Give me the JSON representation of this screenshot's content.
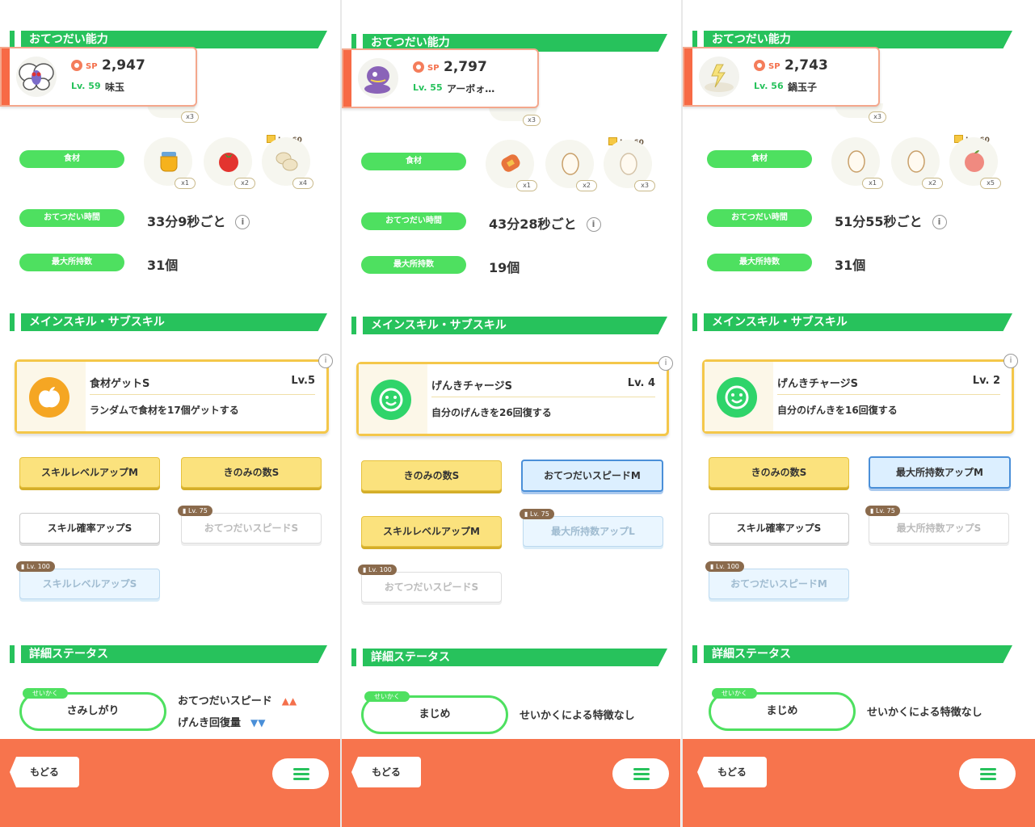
{
  "colors": {
    "green": "#27c25c",
    "orange": "#f7744d",
    "gold": "#fbe27d",
    "blue": "#4a8fd8"
  },
  "labels": {
    "help_section": "おてつだい能力",
    "skill_section": "メインスキル・サブスキル",
    "detail_section": "詳細ステータス",
    "ingredient": "食材",
    "help_time": "おてつだい時間",
    "max_carry": "最大所持数",
    "nature_tag": "せいかく",
    "back": "もどる",
    "sp": "SP",
    "info": "i",
    "locked_icon": "lock-icon",
    "menu_icon": "hamburger-menu-icon"
  },
  "panels": [
    {
      "pokemon": {
        "sp_value": "2,947",
        "level": "Lv. 59",
        "name": "味玉",
        "avatar": "butterfree-icon"
      },
      "top_count": "x3",
      "ingredients": [
        {
          "icon": "honey-icon",
          "count": "x1",
          "lock": ""
        },
        {
          "icon": "tomato-icon",
          "count": "x2",
          "lock": ""
        },
        {
          "icon": "potato-icon",
          "count": "x4",
          "lock": "Lv. 60"
        }
      ],
      "help_time": "33分9秒ごと",
      "max_carry": "31個",
      "main_skill": {
        "name": "食材ゲットS",
        "level": "Lv.5",
        "desc": "ランダムで食材を17個ゲットする",
        "icon": "apple-icon"
      },
      "sub_skills": [
        {
          "label": "スキルレベルアップM",
          "style": "gold",
          "lock": ""
        },
        {
          "label": "きのみの数S",
          "style": "gold",
          "lock": ""
        },
        {
          "label": "スキル確率アップS",
          "style": "white",
          "lock": ""
        },
        {
          "label": "おてつだいスピードS",
          "style": "lwhite",
          "lock": "Lv. 75"
        },
        {
          "label": "スキルレベルアップS",
          "style": "lblue",
          "lock": "Lv. 100"
        }
      ],
      "nature": {
        "name": "さみしがり",
        "up": "おてつだいスピード",
        "up_mark": "▲▲",
        "down": "げんき回復量",
        "down_mark": "▼▼",
        "none": ""
      }
    },
    {
      "pokemon": {
        "sp_value": "2,797",
        "level": "Lv. 55",
        "name": "アーボォ…",
        "avatar": "ekans-icon"
      },
      "top_count": "x3",
      "ingredients": [
        {
          "icon": "sausage-icon",
          "count": "x1",
          "lock": ""
        },
        {
          "icon": "egg-icon",
          "count": "x2",
          "lock": ""
        },
        {
          "icon": "egg-icon",
          "count": "x3",
          "lock": "Lv. 60"
        }
      ],
      "help_time": "43分28秒ごと",
      "max_carry": "19個",
      "main_skill": {
        "name": "げんきチャージS",
        "level": "Lv. 4",
        "desc": "自分のげんきを26回復する",
        "icon": "smile-icon"
      },
      "sub_skills": [
        {
          "label": "きのみの数S",
          "style": "gold",
          "lock": ""
        },
        {
          "label": "おてつだいスピードM",
          "style": "blue",
          "lock": ""
        },
        {
          "label": "スキルレベルアップM",
          "style": "gold",
          "lock": ""
        },
        {
          "label": "最大所持数アップL",
          "style": "lblue",
          "lock": "Lv. 75"
        },
        {
          "label": "おてつだいスピードS",
          "style": "lwhite",
          "lock": "Lv. 100"
        }
      ],
      "nature": {
        "name": "まじめ",
        "up": "",
        "up_mark": "",
        "down": "",
        "down_mark": "",
        "none": "せいかくによる特徴なし"
      }
    },
    {
      "pokemon": {
        "sp_value": "2,743",
        "level": "Lv. 56",
        "name": "鍋玉子",
        "avatar": "pichu-icon"
      },
      "top_count": "x3",
      "ingredients": [
        {
          "icon": "egg-icon",
          "count": "x1",
          "lock": ""
        },
        {
          "icon": "egg-icon",
          "count": "x2",
          "lock": ""
        },
        {
          "icon": "apple-icon",
          "count": "x5",
          "lock": "Lv. 60"
        }
      ],
      "help_time": "51分55秒ごと",
      "max_carry": "31個",
      "main_skill": {
        "name": "げんきチャージS",
        "level": "Lv. 2",
        "desc": "自分のげんきを16回復する",
        "icon": "smile-icon"
      },
      "sub_skills": [
        {
          "label": "きのみの数S",
          "style": "gold",
          "lock": ""
        },
        {
          "label": "最大所持数アップM",
          "style": "blue",
          "lock": ""
        },
        {
          "label": "スキル確率アップS",
          "style": "white",
          "lock": ""
        },
        {
          "label": "最大所持数アップS",
          "style": "lwhite",
          "lock": "Lv. 75"
        },
        {
          "label": "おてつだいスピードM",
          "style": "lblue",
          "lock": "Lv. 100"
        }
      ],
      "nature": {
        "name": "まじめ",
        "up": "",
        "up_mark": "",
        "down": "",
        "down_mark": "",
        "none": "せいかくによる特徴なし"
      }
    }
  ]
}
